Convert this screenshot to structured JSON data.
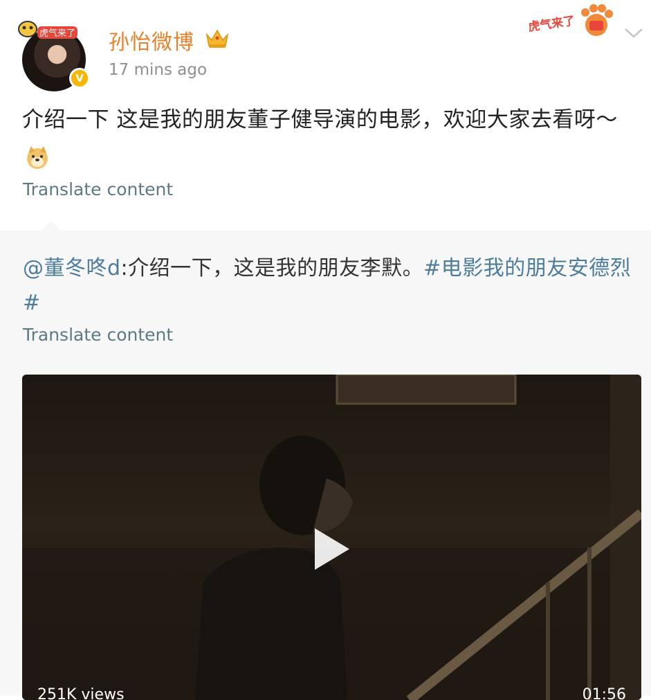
{
  "post": {
    "username": "孙怡微博",
    "time": "17 mins ago",
    "content": "介绍一下 这是我的朋友董子健导演的电影，欢迎大家去看呀～",
    "translate_label": "Translate content",
    "avatar_badge": "V",
    "sticker_text": "虎气来了",
    "icons": [
      "crown-icon",
      "verified-icon",
      "chevron-down-icon",
      "doge-emoji-icon"
    ]
  },
  "repost": {
    "mention": "@董冬咚d",
    "text": ":介绍一下，这是我的朋友李默。",
    "hashtag": "#电影我的朋友安德烈#",
    "translate_label": "Translate content"
  },
  "video": {
    "views": "251K views",
    "duration": "01:56"
  },
  "colors": {
    "username": "#e8812a",
    "link": "#4d7d9e",
    "translate": "#5b7a86",
    "repost_bg": "#f7f7f7"
  }
}
